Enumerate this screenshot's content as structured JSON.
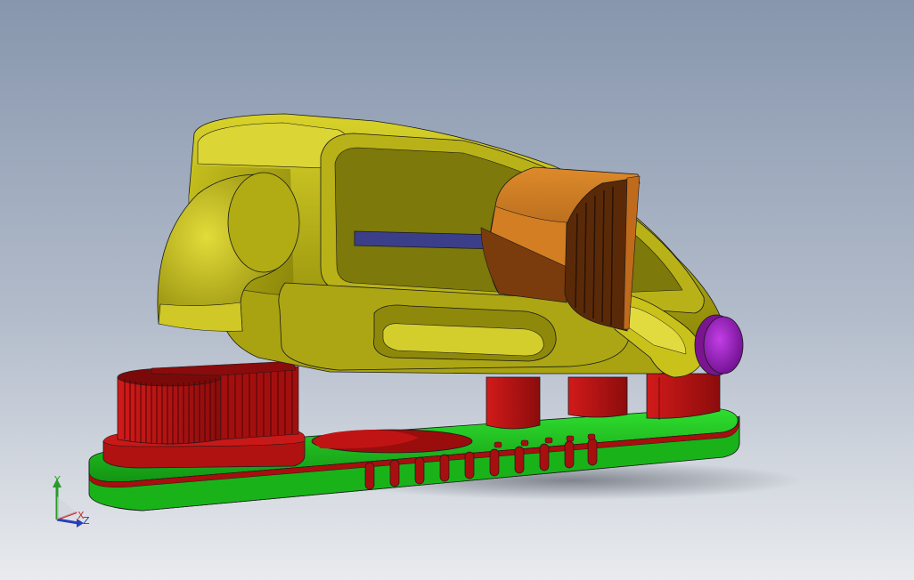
{
  "viewport": {
    "background_top": "#8796ad",
    "background_bottom": "#e9ebee"
  },
  "model": {
    "body_color": "#c9c21a",
    "housing_color": "#d07a1e",
    "slot_color": "#3b3f8a",
    "knob_color": "#a020c8",
    "base_color": "#1ed21e",
    "support_color": "#b11414",
    "bristle_color": "#9c1010"
  },
  "triad": {
    "y_label": "Y",
    "x_label": "X",
    "z_label": "Z",
    "y_color": "#2a9a2a",
    "x_color": "#c23030",
    "z_color": "#2a3fb6"
  }
}
